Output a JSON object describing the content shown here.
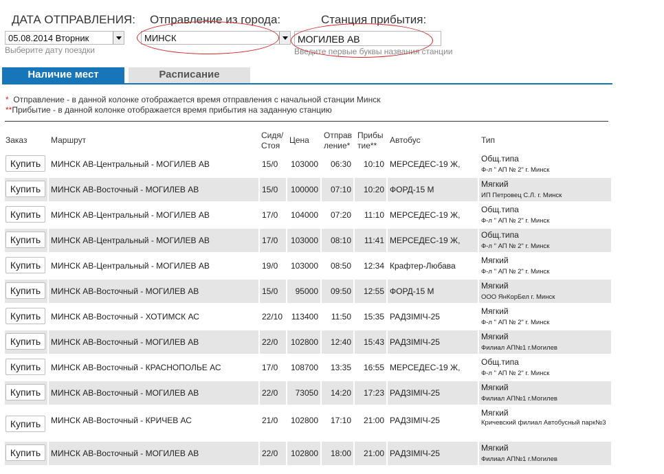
{
  "form": {
    "date_label": "ДАТА ОТПРАВЛЕНИЯ:",
    "date_value": "05.08.2014 Вторник",
    "date_hint": "Выберите дату поездки",
    "from_label": "Отправление из города:",
    "from_value": "МИНСК",
    "to_label": "Станция прибытия:",
    "to_value": "МОГИЛЕВ АВ",
    "to_hint": "Введите первые буквы названия станции"
  },
  "tabs": {
    "active": "Наличие мест",
    "inactive": "Расписание"
  },
  "notes": {
    "n1_star": "*",
    "n1_text": "Отправление - в данной колонке отображается время отправления с начальной станции Минск",
    "n2_star": "**",
    "n2_text": "Прибытие - в данной колонке отображается время прибытия на заданную станцию"
  },
  "table": {
    "headers": {
      "order": "Заказ",
      "route": "Маршрут",
      "seats_1": "Сидя/",
      "seats_2": "Стоя",
      "price": "Цена",
      "dep_1": "Отправ",
      "dep_2": "ление*",
      "arr_1": "Прибы",
      "arr_2": "тие**",
      "bus": "Автобус",
      "type": "Тип"
    },
    "buy_label": "Купить",
    "rows": [
      {
        "route": "МИНСК АВ-Центральный - МОГИЛЕВ АВ",
        "seats": "15/0",
        "price": "103000",
        "dep": "06:30",
        "arr": "10:10",
        "bus": "МЕРСЕДЕС-19 Ж,",
        "type": "Общ.типа",
        "operator": "Ф-л \" АП № 2\" г. Минск"
      },
      {
        "route": "МИНСК АВ-Восточный - МОГИЛЕВ АВ",
        "seats": "15/0",
        "price": "100000",
        "dep": "07:10",
        "arr": "10:20",
        "bus": "ФОРД-15 М",
        "type": "Мягкий",
        "operator": "ИП Петровец С.Л. г. Минск"
      },
      {
        "route": "МИНСК АВ-Центральный - МОГИЛЕВ АВ",
        "seats": "17/0",
        "price": "104000",
        "dep": "07:20",
        "arr": "11:10",
        "bus": "МЕРСЕДЕС-19 Ж,",
        "type": "Общ.типа",
        "operator": "Ф-л \" АП № 2\" г. Минск"
      },
      {
        "route": "МИНСК АВ-Центральный - МОГИЛЕВ АВ",
        "seats": "17/0",
        "price": "103000",
        "dep": "08:10",
        "arr": "11:41",
        "bus": "МЕРСЕДЕС-19 Ж,",
        "type": "Общ.типа",
        "operator": "Ф-л \" АП № 2\" г. Минск"
      },
      {
        "route": "МИНСК АВ-Центральный - МОГИЛЕВ АВ",
        "seats": "19/0",
        "price": "103000",
        "dep": "08:50",
        "arr": "12:34",
        "bus": "Крафтер-Любава",
        "type": "Мягкий",
        "operator": "Ф-л \" АП № 2\" г. Минск"
      },
      {
        "route": "МИНСК АВ-Восточный - МОГИЛЕВ АВ",
        "seats": "15/0",
        "price": "95000",
        "dep": "09:50",
        "arr": "12:55",
        "bus": "ФОРД-15 М",
        "type": "Мягкий",
        "operator": "ООО ЯнКорБел г. Минск"
      },
      {
        "route": "МИНСК АВ-Восточный - ХОТИМСК АС",
        "seats": "22/10",
        "price": "113400",
        "dep": "11:50",
        "arr": "15:35",
        "bus": "РАДЗІМІЧ-25",
        "type": "Мягкий",
        "operator": "Ф-л \" АП № 2\" г. Минск"
      },
      {
        "route": "МИНСК АВ-Восточный - МОГИЛЕВ АВ",
        "seats": "22/0",
        "price": "102800",
        "dep": "12:40",
        "arr": "15:43",
        "bus": "РАДЗІМІЧ-25",
        "type": "Мягкий",
        "operator": "Филиал АП№1 г.Могилев"
      },
      {
        "route": "МИНСК АВ-Восточный - КРАСНОПОЛЬЕ АС",
        "seats": "17/0",
        "price": "108700",
        "dep": "13:35",
        "arr": "16:55",
        "bus": "МЕРСЕДЕС-19 Ж,",
        "type": "Общ.типа",
        "operator": "Ф-л \" АП № 2\" г. Минск"
      },
      {
        "route": "МИНСК АВ-Восточный - МОГИЛЕВ АВ",
        "seats": "22/0",
        "price": "73050",
        "dep": "14:20",
        "arr": "17:23",
        "bus": "РАДЗІМІЧ-25",
        "type": "Мягкий",
        "operator": "Филиал АП№1 г.Могилев"
      },
      {
        "route": "МИНСК АВ-Восточный - КРИЧЕВ АС",
        "seats": "21/0",
        "price": "102800",
        "dep": "17:10",
        "arr": "21:00",
        "bus": "РАДЗІМІЧ-25",
        "type": "Мягкий",
        "operator": "Кричевский филиал Автобусный парк№3"
      },
      {
        "route": "МИНСК АВ-Восточный - МОГИЛЕВ АВ",
        "seats": "22/0",
        "price": "102800",
        "dep": "18:00",
        "arr": "21:00",
        "bus": "РАДЗІМІЧ-25",
        "type": "Мягкий",
        "operator": "Филиал АП№1 г.Могилев"
      }
    ]
  }
}
